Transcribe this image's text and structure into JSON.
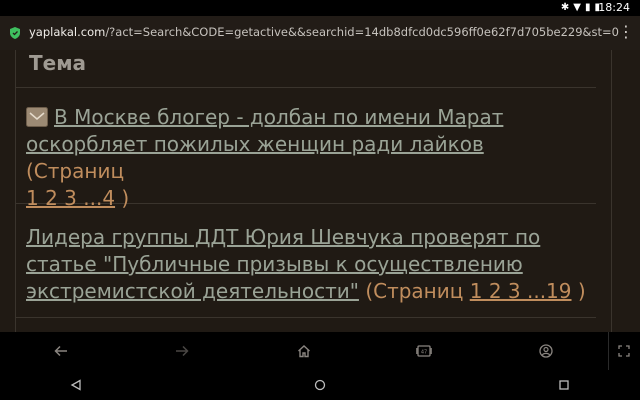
{
  "status": {
    "time": "18:24"
  },
  "browser": {
    "url_host": "yaplakal.com",
    "url_path": "/?act=Search&CODE=getactive&&searchid=14db8dfcd0dc596ff0e62f7d705be229&st=0"
  },
  "table": {
    "header": "Тема",
    "topics": [
      {
        "title": "В Москве блогер - долбан по имени Марат оскорбляет пожилых женщин ради лайков",
        "pages_label": "(Страниц",
        "pages": "1 2 3 ...4",
        "close": ")"
      },
      {
        "title": "Лидера группы ДДТ Юрия Шевчука проверят по статье \"Публичные призывы к осуществлению экстремистской деятельности\"",
        "pages_label": "(Страниц",
        "pages": "1 2 3 ...19",
        "close": ")"
      }
    ]
  },
  "icons": {
    "back": "arrow-left-icon",
    "forward": "arrow-right-icon",
    "home": "home-icon",
    "tabs": "tabs-icon",
    "account": "account-icon",
    "fullscreen": "fullscreen-icon"
  },
  "colors": {
    "background": "#201a14",
    "link": "#9aa396",
    "pages": "#c08d5d"
  }
}
